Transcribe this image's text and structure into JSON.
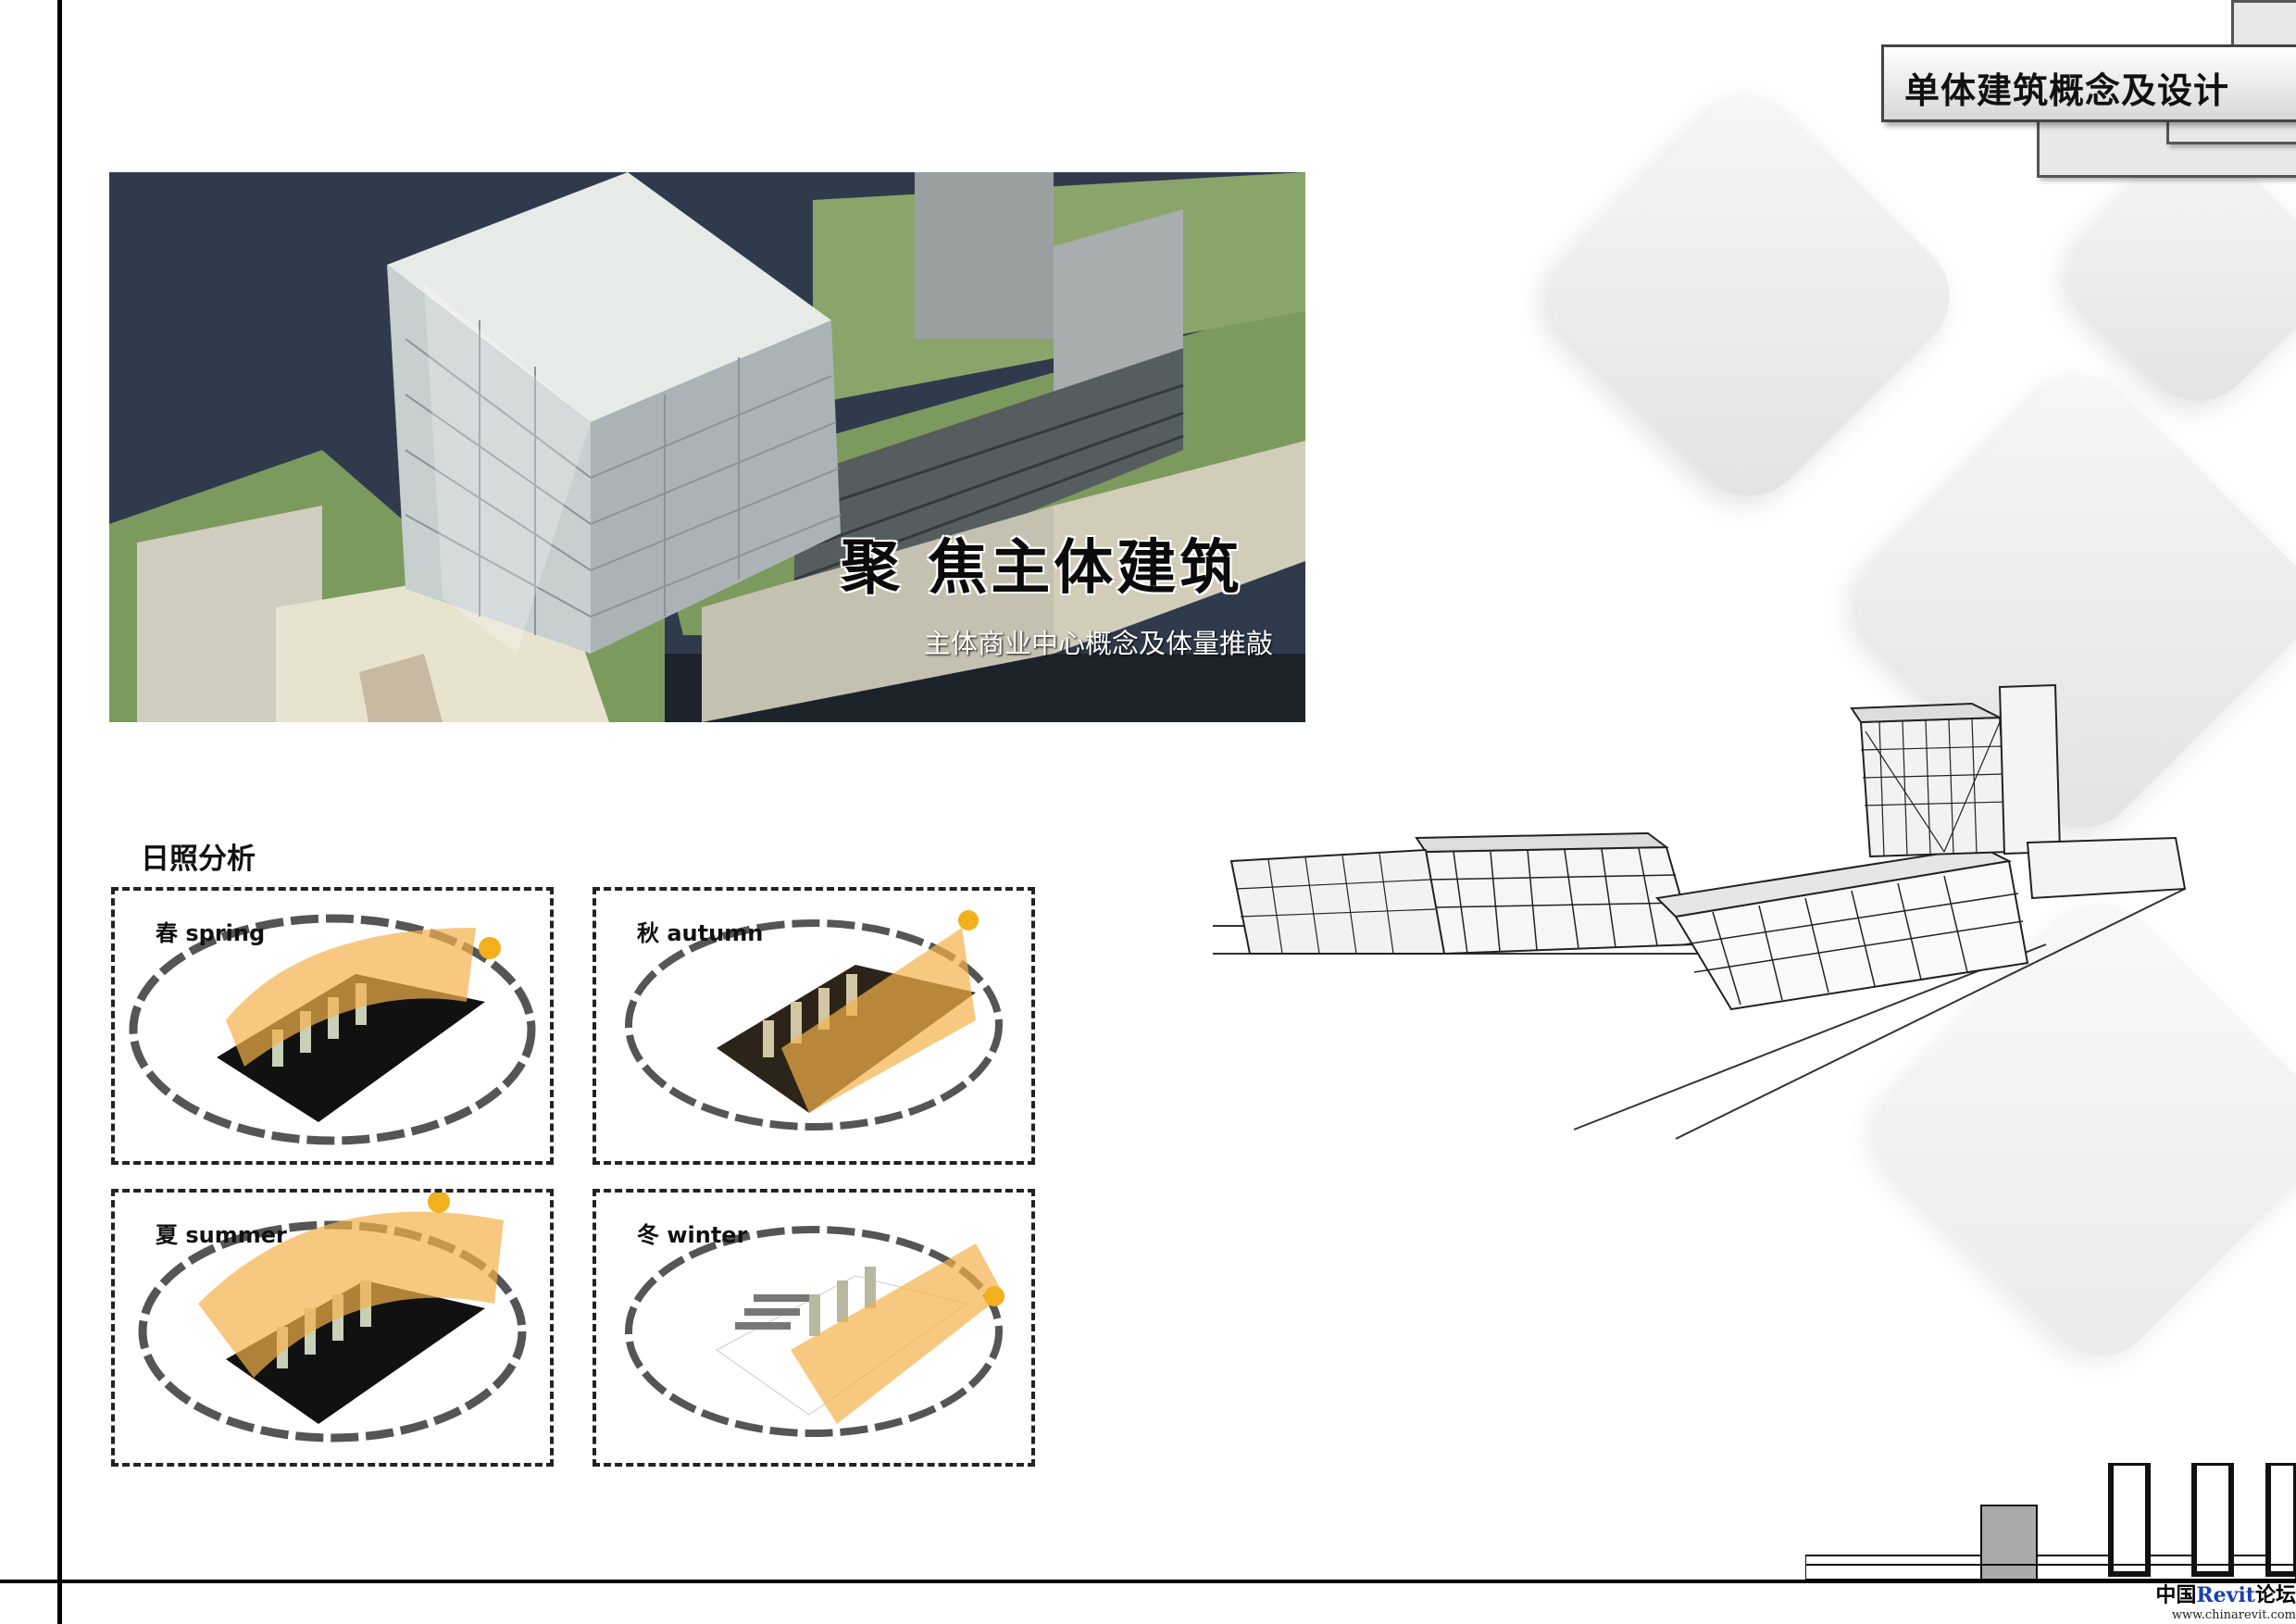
{
  "header": {
    "title": "单体建筑概念及设计"
  },
  "hero": {
    "title": "聚 焦主体建筑",
    "subtitle": "主体商业中心概念及体量推敲"
  },
  "sun_analysis": {
    "label": "日照分析",
    "panels": [
      {
        "season": "春 spring"
      },
      {
        "season": "秋 autumn"
      },
      {
        "season": "夏 summer"
      },
      {
        "season": "冬 winter"
      }
    ]
  },
  "watermark": {
    "brand_prefix": "中国",
    "brand_highlight": "Revit",
    "brand_suffix": "论坛",
    "url": "www.chinarevit.com"
  },
  "colors": {
    "grass": "#7d9a5e",
    "water": "#2f3b4d",
    "sun_dome": "#f4b24a",
    "glass": "#b8c2c6",
    "frame": "#000000"
  }
}
